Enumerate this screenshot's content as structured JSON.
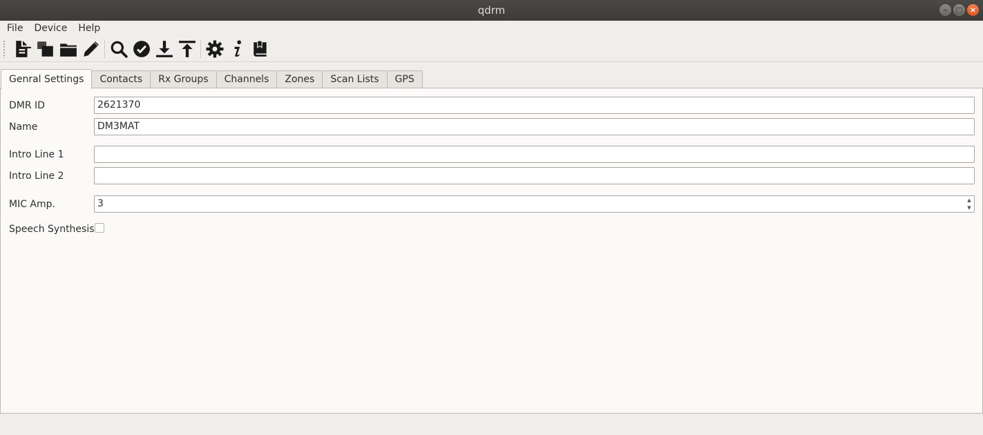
{
  "window": {
    "title": "qdrm",
    "controls": [
      "minimize-icon",
      "maximize-icon",
      "close-icon"
    ]
  },
  "menubar": {
    "items": [
      {
        "label": "File"
      },
      {
        "label": "Device"
      },
      {
        "label": "Help"
      }
    ]
  },
  "toolbar": {
    "icons": [
      "new-document-icon",
      "copy-icon",
      "open-folder-icon",
      "edit-pencil-icon",
      "search-icon",
      "verify-check-icon",
      "download-icon",
      "upload-icon",
      "settings-gear-icon",
      "info-icon",
      "bookmark-book-icon"
    ]
  },
  "tabs": [
    {
      "label": "Genral Settings",
      "active": true
    },
    {
      "label": "Contacts"
    },
    {
      "label": "Rx Groups"
    },
    {
      "label": "Channels"
    },
    {
      "label": "Zones"
    },
    {
      "label": "Scan Lists"
    },
    {
      "label": "GPS"
    }
  ],
  "settings": {
    "dmr_id": {
      "label": "DMR ID",
      "value": "2621370"
    },
    "name": {
      "label": "Name",
      "value": "DM3MAT"
    },
    "intro_line_1": {
      "label": "Intro Line 1",
      "value": ""
    },
    "intro_line_2": {
      "label": "Intro Line 2",
      "value": ""
    },
    "mic_amp": {
      "label": "MIC Amp.",
      "value": "3"
    },
    "speech_synthesis": {
      "label": "Speech Synthesis",
      "checked": false
    }
  },
  "colors": {
    "titlebar": "#3c3b37",
    "close_button": "#e0561f",
    "panel_background": "#fcfaf8",
    "window_background": "#f0eeeb"
  }
}
